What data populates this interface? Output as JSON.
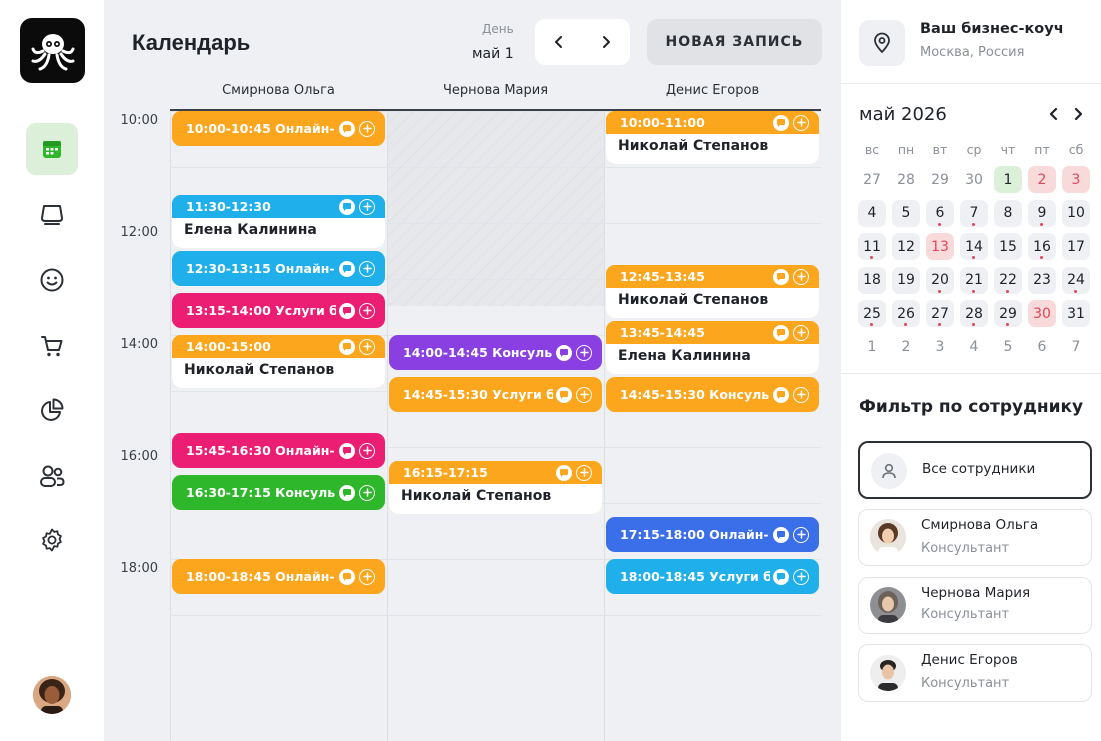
{
  "colors": {
    "orange": "#fba61d",
    "blue": "#1fb0ec",
    "pink": "#ec1e74",
    "green": "#2fb72c",
    "purple": "#8a3fe3",
    "royal": "#3b6ee9",
    "accent_green_bg": "#dcefd8",
    "accent_red": "#e0475a"
  },
  "nav": {
    "items": [
      {
        "name": "nav-calendar",
        "icon": "calendar-icon"
      },
      {
        "name": "nav-services",
        "icon": "tray-icon"
      },
      {
        "name": "nav-clients",
        "icon": "smile-icon"
      },
      {
        "name": "nav-shop",
        "icon": "cart-icon"
      },
      {
        "name": "nav-reports",
        "icon": "pie-chart-icon"
      },
      {
        "name": "nav-staff",
        "icon": "users-icon"
      },
      {
        "name": "nav-settings",
        "icon": "gear-icon"
      }
    ]
  },
  "header": {
    "title": "Календарь",
    "view_mode": "День",
    "current_date": "май 1",
    "new_button": "НОВАЯ ЗАПИСЬ"
  },
  "schedule": {
    "columns": [
      "Смирнова Ольга",
      "Чернова Мария",
      "Денис Егоров"
    ],
    "times": [
      "10:00",
      "12:00",
      "14:00",
      "16:00",
      "18:00"
    ],
    "events": [
      {
        "col": 0,
        "start": "10:00",
        "label": "10:00-10:45 Онлайн-",
        "color": "orange"
      },
      {
        "col": 0,
        "start": "11:30",
        "label": "11:30-12:30",
        "client": "Елена Калинина",
        "color": "blue"
      },
      {
        "col": 0,
        "start": "12:30",
        "label": "12:30-13:15 Онлайн-",
        "color": "blue"
      },
      {
        "col": 0,
        "start": "13:15",
        "label": "13:15-14:00 Услуги б",
        "color": "pink"
      },
      {
        "col": 0,
        "start": "14:00",
        "label": "14:00-15:00",
        "client": "Николай Степанов",
        "color": "orange"
      },
      {
        "col": 0,
        "start": "15:45",
        "label": "15:45-16:30 Онлайн-",
        "color": "pink"
      },
      {
        "col": 0,
        "start": "16:30",
        "label": "16:30-17:15 Консуль",
        "color": "green"
      },
      {
        "col": 0,
        "start": "18:00",
        "label": "18:00-18:45 Онлайн-",
        "color": "orange"
      },
      {
        "col": 1,
        "start": "14:00",
        "label": "14:00-14:45 Консуль",
        "color": "purple"
      },
      {
        "col": 1,
        "start": "14:45",
        "label": "14:45-15:30 Услуги б",
        "color": "orange"
      },
      {
        "col": 1,
        "start": "16:15",
        "label": "16:15-17:15",
        "client": "Николай Степанов",
        "color": "orange"
      },
      {
        "col": 2,
        "start": "10:00",
        "label": "10:00-11:00",
        "client": "Николай Степанов",
        "color": "orange"
      },
      {
        "col": 2,
        "start": "12:45",
        "label": "12:45-13:45",
        "client": "Николай Степанов",
        "color": "orange"
      },
      {
        "col": 2,
        "start": "13:45",
        "label": "13:45-14:45",
        "client": "Елена Калинина",
        "color": "orange"
      },
      {
        "col": 2,
        "start": "14:45",
        "label": "14:45-15:30 Консуль",
        "color": "orange"
      },
      {
        "col": 2,
        "start": "17:15",
        "label": "17:15-18:00 Онлайн-",
        "color": "royal"
      },
      {
        "col": 2,
        "start": "18:00",
        "label": "18:00-18:45 Услуги б",
        "color": "blue"
      }
    ]
  },
  "business": {
    "name": "Ваш бизнес-коуч",
    "location": "Москва, Россия",
    "icon": "location-pin-icon"
  },
  "mini_calendar": {
    "title": "май 2026",
    "weekdays": [
      "вс",
      "пн",
      "вт",
      "ср",
      "чт",
      "пт",
      "сб"
    ],
    "weeks": [
      [
        [
          "27",
          "other"
        ],
        [
          "28",
          "other"
        ],
        [
          "29",
          "other"
        ],
        [
          "30",
          "other"
        ],
        [
          "1",
          "green"
        ],
        [
          "2",
          "red"
        ],
        [
          "3",
          "red"
        ]
      ],
      [
        [
          "4",
          "busy"
        ],
        [
          "5",
          "busy"
        ],
        [
          "6",
          "busy-dot"
        ],
        [
          "7",
          "busy-dot"
        ],
        [
          "8",
          "busy"
        ],
        [
          "9",
          "busy-dot"
        ],
        [
          "10",
          "busy"
        ]
      ],
      [
        [
          "11",
          "busy-dot"
        ],
        [
          "12",
          "busy"
        ],
        [
          "13",
          "red"
        ],
        [
          "14",
          "busy-dot"
        ],
        [
          "15",
          "busy"
        ],
        [
          "16",
          "busy-dot"
        ],
        [
          "17",
          "busy"
        ]
      ],
      [
        [
          "18",
          "busy"
        ],
        [
          "19",
          "busy"
        ],
        [
          "20",
          "busy-dot"
        ],
        [
          "21",
          "busy-dot"
        ],
        [
          "22",
          "busy-dot"
        ],
        [
          "23",
          "busy"
        ],
        [
          "24",
          "busy-dot"
        ]
      ],
      [
        [
          "25",
          "busy-dot"
        ],
        [
          "26",
          "busy-dot"
        ],
        [
          "27",
          "busy-dot"
        ],
        [
          "28",
          "busy-dot"
        ],
        [
          "29",
          "busy-dot"
        ],
        [
          "30",
          "red"
        ],
        [
          "31",
          "busy"
        ]
      ],
      [
        [
          "1",
          "other"
        ],
        [
          "2",
          "other"
        ],
        [
          "3",
          "other"
        ],
        [
          "4",
          "other"
        ],
        [
          "5",
          "other"
        ],
        [
          "6",
          "other"
        ],
        [
          "7",
          "other"
        ]
      ]
    ]
  },
  "filter": {
    "title": "Фильтр по сотруднику",
    "all_label": "Все сотрудники",
    "employees": [
      {
        "name": "Смирнова Ольга",
        "role": "Консультант"
      },
      {
        "name": "Чернова Мария",
        "role": "Консультант"
      },
      {
        "name": "Денис Егоров",
        "role": "Консультант"
      }
    ]
  }
}
